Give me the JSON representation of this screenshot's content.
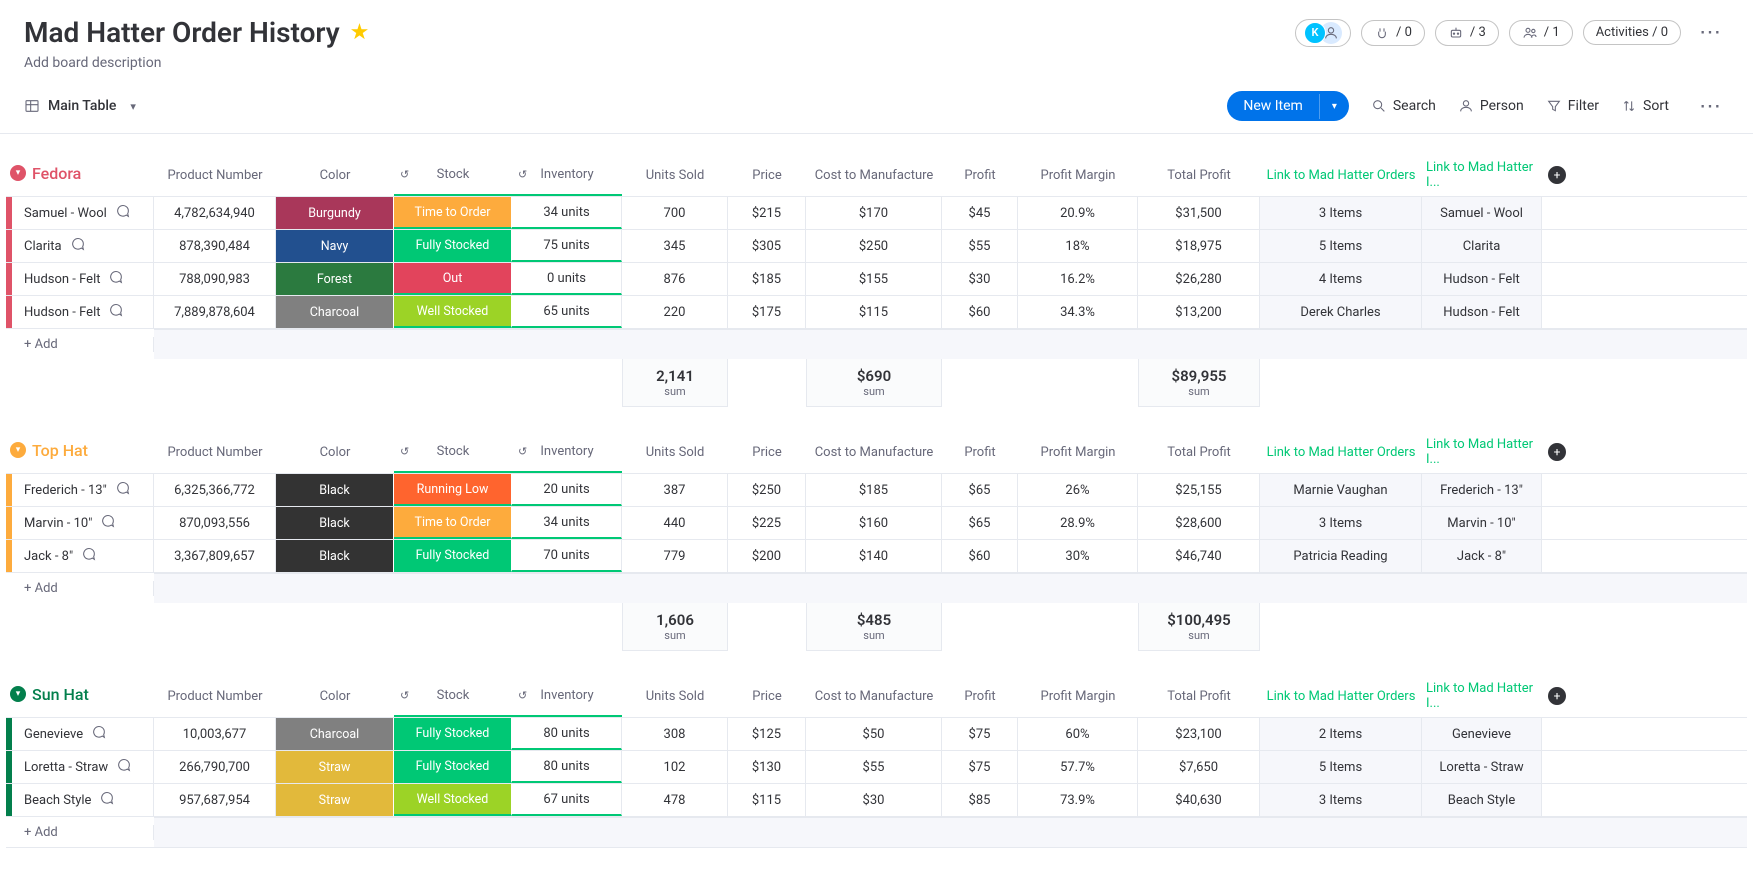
{
  "header": {
    "title": "Mad Hatter Order History",
    "add_description": "Add board description",
    "avatar_k": "K",
    "integrations_count": "/ 0",
    "automations_count": "/ 3",
    "members_count": "/ 1",
    "activities": "Activities / 0"
  },
  "toolbar": {
    "view_label": "Main Table",
    "new_item": "New Item",
    "search": "Search",
    "person": "Person",
    "filter": "Filter",
    "sort": "Sort"
  },
  "columns": {
    "product_number": "Product Number",
    "color": "Color",
    "stock": "Stock",
    "inventory": "Inventory",
    "units_sold": "Units Sold",
    "price": "Price",
    "cost": "Cost to Manufacture",
    "profit": "Profit",
    "margin": "Profit Margin",
    "total_profit": "Total Profit",
    "link1": "Link to Mad Hatter Orders",
    "link2": "Link to Mad Hatter I...",
    "add_label": "+ Add",
    "sum_label": "sum"
  },
  "status_colors": {
    "Burgundy": "#a9375a",
    "Navy": "#22508f",
    "Forest": "#2b7a3f",
    "Charcoal": "#808080",
    "Black": "#333333",
    "Straw": "#e2b93b",
    "Time to Order": "#fdab3d",
    "Fully Stocked": "#00c875",
    "Out": "#e2445c",
    "Well Stocked": "#9cd326",
    "Running Low": "#ff642e"
  },
  "groups": [
    {
      "id": "fedora",
      "name": "Fedora",
      "rows": [
        {
          "name": "Samuel - Wool",
          "product": "4,782,634,940",
          "color": "Burgundy",
          "stock": "Time to Order",
          "inventory": "34 units",
          "units": "700",
          "price": "$215",
          "cost": "$170",
          "profit": "$45",
          "margin": "20.9%",
          "tprofit": "$31,500",
          "link1": "3 Items",
          "link2": "Samuel - Wool"
        },
        {
          "name": "Clarita",
          "product": "878,390,484",
          "color": "Navy",
          "stock": "Fully Stocked",
          "inventory": "75 units",
          "units": "345",
          "price": "$305",
          "cost": "$250",
          "profit": "$55",
          "margin": "18%",
          "tprofit": "$18,975",
          "link1": "5 Items",
          "link2": "Clarita"
        },
        {
          "name": "Hudson - Felt",
          "product": "788,090,983",
          "color": "Forest",
          "stock": "Out",
          "inventory": "0 units",
          "units": "876",
          "price": "$185",
          "cost": "$155",
          "profit": "$30",
          "margin": "16.2%",
          "tprofit": "$26,280",
          "link1": "4 Items",
          "link2": "Hudson - Felt"
        },
        {
          "name": "Hudson - Felt",
          "product": "7,889,878,604",
          "color": "Charcoal",
          "stock": "Well Stocked",
          "inventory": "65 units",
          "units": "220",
          "price": "$175",
          "cost": "$115",
          "profit": "$60",
          "margin": "34.3%",
          "tprofit": "$13,200",
          "link1": "Derek Charles",
          "link2": "Hudson - Felt"
        }
      ],
      "sums": {
        "units": "2,141",
        "cost": "$690",
        "tprofit": "$89,955"
      }
    },
    {
      "id": "tophat",
      "name": "Top Hat",
      "rows": [
        {
          "name": "Frederich - 13\"",
          "product": "6,325,366,772",
          "color": "Black",
          "stock": "Running Low",
          "inventory": "20 units",
          "units": "387",
          "price": "$250",
          "cost": "$185",
          "profit": "$65",
          "margin": "26%",
          "tprofit": "$25,155",
          "link1": "Marnie Vaughan",
          "link2": "Frederich - 13\""
        },
        {
          "name": "Marvin - 10\"",
          "product": "870,093,556",
          "color": "Black",
          "stock": "Time to Order",
          "inventory": "34 units",
          "units": "440",
          "price": "$225",
          "cost": "$160",
          "profit": "$65",
          "margin": "28.9%",
          "tprofit": "$28,600",
          "link1": "3 Items",
          "link2": "Marvin - 10\""
        },
        {
          "name": "Jack - 8\"",
          "product": "3,367,809,657",
          "color": "Black",
          "stock": "Fully Stocked",
          "inventory": "70 units",
          "units": "779",
          "price": "$200",
          "cost": "$140",
          "profit": "$60",
          "margin": "30%",
          "tprofit": "$46,740",
          "link1": "Patricia Reading",
          "link2": "Jack - 8\""
        }
      ],
      "sums": {
        "units": "1,606",
        "cost": "$485",
        "tprofit": "$100,495"
      }
    },
    {
      "id": "sunhat",
      "name": "Sun Hat",
      "rows": [
        {
          "name": "Genevieve",
          "product": "10,003,677",
          "color": "Charcoal",
          "stock": "Fully Stocked",
          "inventory": "80 units",
          "units": "308",
          "price": "$125",
          "cost": "$50",
          "profit": "$75",
          "margin": "60%",
          "tprofit": "$23,100",
          "link1": "2 Items",
          "link2": "Genevieve"
        },
        {
          "name": "Loretta - Straw",
          "product": "266,790,700",
          "color": "Straw",
          "stock": "Fully Stocked",
          "inventory": "80 units",
          "units": "102",
          "price": "$130",
          "cost": "$55",
          "profit": "$75",
          "margin": "57.7%",
          "tprofit": "$7,650",
          "link1": "5 Items",
          "link2": "Loretta - Straw"
        },
        {
          "name": "Beach Style",
          "product": "957,687,954",
          "color": "Straw",
          "stock": "Well Stocked",
          "inventory": "67 units",
          "units": "478",
          "price": "$115",
          "cost": "$30",
          "profit": "$85",
          "margin": "73.9%",
          "tprofit": "$40,630",
          "link1": "3 Items",
          "link2": "Beach Style"
        }
      ],
      "sums": null
    }
  ]
}
